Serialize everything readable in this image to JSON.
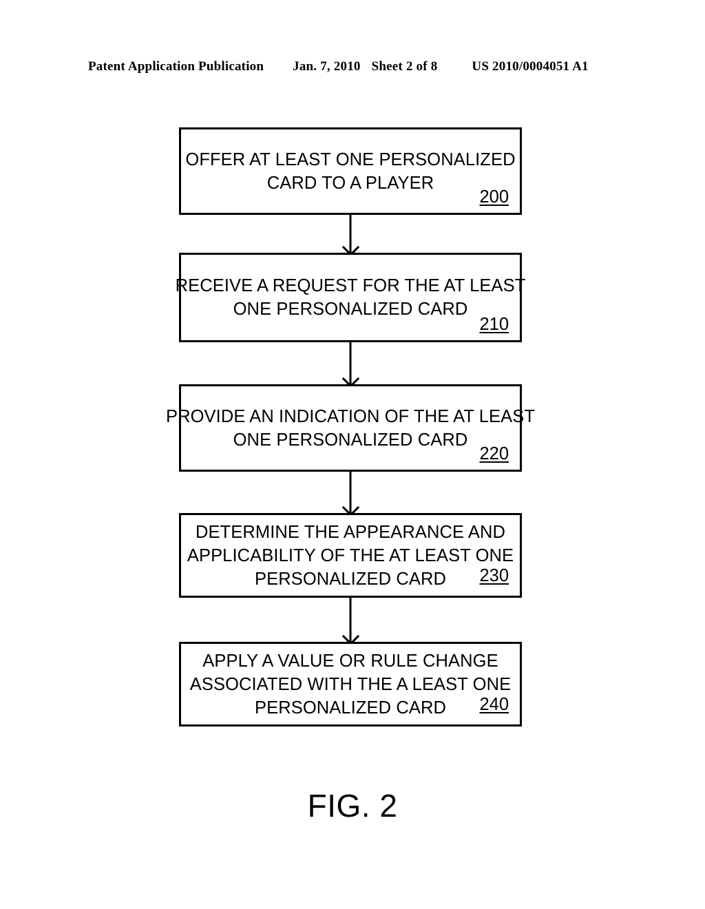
{
  "header": {
    "publication_label": "Patent Application Publication",
    "date": "Jan. 7, 2010",
    "sheet": "Sheet 2 of 8",
    "patent_number": "US 2010/0004051 A1"
  },
  "figure": {
    "caption": "FIG. 2",
    "steps": [
      {
        "ref": "200",
        "lines": [
          "OFFER AT LEAST ONE PERSONALIZED",
          "CARD TO A PLAYER"
        ],
        "line1": "OFFER AT LEAST ONE PERSONALIZED",
        "line2": "CARD TO A PLAYER",
        "line3": ""
      },
      {
        "ref": "210",
        "lines": [
          "RECEIVE A REQUEST FOR THE AT LEAST",
          "ONE PERSONALIZED CARD"
        ],
        "line1": "RECEIVE A REQUEST FOR THE AT LEAST",
        "line2": "ONE PERSONALIZED CARD",
        "line3": ""
      },
      {
        "ref": "220",
        "lines": [
          "PROVIDE AN INDICATION OF THE AT LEAST",
          "ONE PERSONALIZED CARD"
        ],
        "line1": "PROVIDE AN INDICATION OF THE AT LEAST",
        "line2": "ONE PERSONALIZED CARD",
        "line3": ""
      },
      {
        "ref": "230",
        "lines": [
          "DETERMINE THE APPEARANCE AND",
          "APPLICABILITY OF THE AT LEAST ONE",
          "PERSONALIZED CARD"
        ],
        "line1": "DETERMINE THE APPEARANCE AND",
        "line2": "APPLICABILITY OF THE AT LEAST ONE",
        "line3": "PERSONALIZED CARD"
      },
      {
        "ref": "240",
        "lines": [
          "APPLY A VALUE OR RULE CHANGE",
          "ASSOCIATED WITH THE A LEAST ONE",
          "PERSONALIZED CARD"
        ],
        "line1": "APPLY A VALUE OR RULE CHANGE",
        "line2": "ASSOCIATED WITH THE A LEAST ONE",
        "line3": "PERSONALIZED CARD"
      }
    ]
  },
  "style": {
    "ink": "#000000",
    "paper": "#ffffff"
  }
}
